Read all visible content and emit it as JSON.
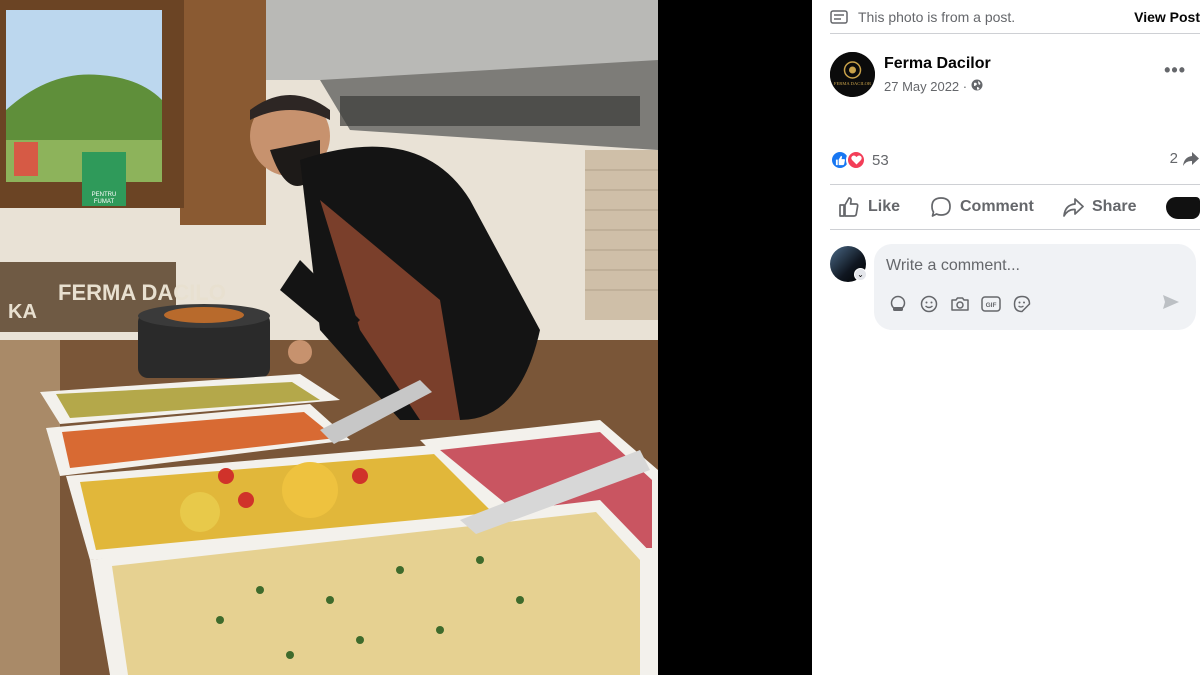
{
  "post_note": {
    "icon": "post-note-icon",
    "text": "This photo is from a post.",
    "view_post_label": "View Post"
  },
  "author": {
    "name": "Ferma Dacilor",
    "date": "27 May 2022 ·",
    "avatar_text": "FERMA DACILOR",
    "privacy_icon": "globe-icon"
  },
  "reactions": {
    "count": "53",
    "shares": "2",
    "types": [
      "like",
      "love"
    ]
  },
  "actions": {
    "like_label": "Like",
    "comment_label": "Comment",
    "share_label": "Share"
  },
  "comment": {
    "placeholder": "Write a comment...",
    "icons": [
      "avatar-sticker-icon",
      "emoji-icon",
      "camera-icon",
      "gif-icon",
      "sticker-icon"
    ],
    "send_icon": "send-icon"
  },
  "photo": {
    "sign_text": "FERMA DACILO",
    "sign_prefix": "KA",
    "no_smoking_text": "FUMAT",
    "no_smoking_line": "PENTRU"
  },
  "colors": {
    "accent": "#1877f2",
    "love": "#f33e58",
    "secondary_text": "#65676b",
    "panel_bg": "#ffffff",
    "comment_bg": "#f0f2f5"
  }
}
